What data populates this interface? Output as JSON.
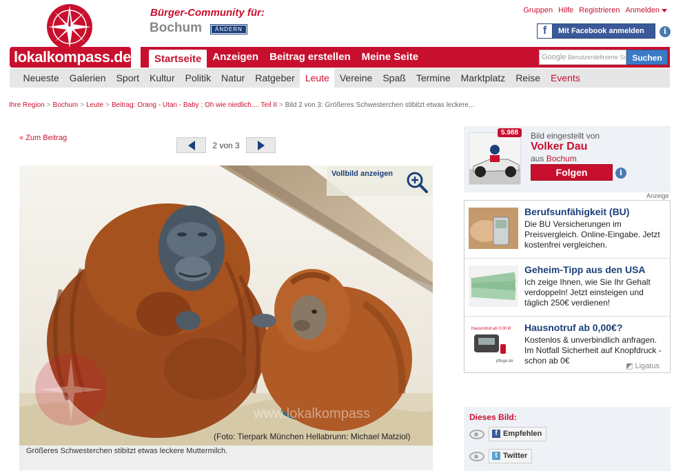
{
  "header": {
    "logo_text": "lokalkompass.de",
    "community_label": "Bürger-Community für:",
    "city": "Bochum",
    "change_label": "ÄNDERN",
    "top_links": [
      "Gruppen",
      "Hilfe",
      "Registrieren",
      "Anmelden"
    ],
    "facebook_button": "Mit Facebook anmelden"
  },
  "main_nav": {
    "items": [
      "Startseite",
      "Anzeigen",
      "Beitrag erstellen",
      "Meine Seite"
    ],
    "active": "Startseite"
  },
  "search": {
    "google_label": "Google",
    "placeholder": "Benutzerdefinierte Suche",
    "button": "Suchen"
  },
  "sub_nav": {
    "items": [
      "Neueste",
      "Galerien",
      "Sport",
      "Kultur",
      "Politik",
      "Natur",
      "Ratgeber",
      "Leute",
      "Vereine",
      "Spaß",
      "Termine",
      "Marktplatz",
      "Reise",
      "Events"
    ],
    "active": "Leute"
  },
  "breadcrumb": {
    "items": [
      "Ihre Region",
      "Bochum",
      "Leute",
      "Beitrag: Orang - Utan - Baby ; Oh wie niedlich.... Teil II"
    ],
    "current": "Bild 2 von 3: Größeres Schwesterchen stibitzt etwas leckere..."
  },
  "gallery": {
    "back_label": "Zum Beitrag",
    "counter": "2 von 3",
    "fullview_label": "Vollbild anzeigen",
    "credit": "(Foto: Tierpark München Hellabrunn: Michael Matziol)",
    "caption": "Größeres Schwesterchen stibitzt etwas leckere Muttermilch.",
    "watermark": "www.lokalkompass"
  },
  "user": {
    "badge": "5.988",
    "label": "Bild eingestellt von",
    "name": "Volker Dau",
    "city_prefix": "aus",
    "city": "Bochum",
    "follow": "Folgen"
  },
  "ads_label": "Anzeige",
  "ads": [
    {
      "title": "Berufsunfähigkeit (BU)",
      "body": "Die BU Versicherungen im Preisvergleich. Online-Eingabe. Jetzt kostenfrei vergleichen."
    },
    {
      "title": "Geheim-Tipp aus den USA",
      "body": "Ich zeige Ihnen, wie Sie Ihr Gehalt verdoppeln! Jetzt einsteigen und täglich 250€ verdienen!"
    },
    {
      "title": "Hausnotruf ab 0,00€?",
      "body": "Kostenlos & unverbindlich anfragen. Im Notfall Sicherheit auf Knopfdruck - schon ab 0€",
      "thumb_text": "Hausnotruf ab 0,00 €!",
      "thumb_brand": "pflege.de"
    }
  ],
  "ads_brand": "Ligatus",
  "share": {
    "label": "Dieses Bild:",
    "facebook": "Empfehlen",
    "twitter": "Twitter"
  },
  "colors": {
    "brand_red": "#c8102e",
    "link_blue": "#1b3f7a",
    "facebook_blue": "#3b5998"
  }
}
